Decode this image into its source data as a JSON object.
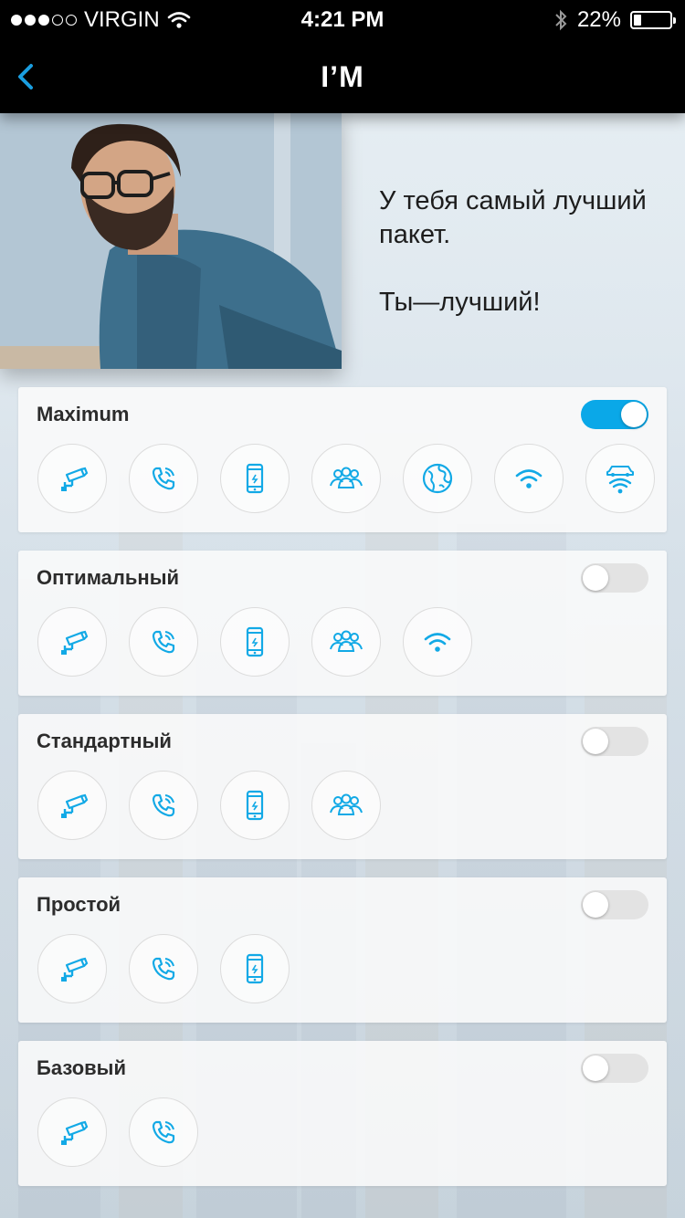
{
  "status": {
    "carrier": "VIRGIN",
    "time": "4:21 PM",
    "battery": "22%",
    "battery_level": 0.22,
    "signal_bars": 3,
    "signal_total": 5
  },
  "nav": {
    "title": "I’M",
    "back_icon": "chevron-left-icon"
  },
  "hero": {
    "line1": "У тебя самый лучший пакет.",
    "line2": "Ты—лучший!"
  },
  "colors": {
    "accent": "#0aa8e8",
    "icon": "#12a9e6",
    "bar": "#000000"
  },
  "plans": [
    {
      "name": "Maximum",
      "enabled": true,
      "features": [
        "camera",
        "phone",
        "mobile",
        "group",
        "globe",
        "wifi",
        "car-wifi"
      ]
    },
    {
      "name": "Оптимальный",
      "enabled": false,
      "features": [
        "camera",
        "phone",
        "mobile",
        "group",
        "wifi"
      ]
    },
    {
      "name": "Стандартный",
      "enabled": false,
      "features": [
        "camera",
        "phone",
        "mobile",
        "group"
      ]
    },
    {
      "name": "Простой",
      "enabled": false,
      "features": [
        "camera",
        "phone",
        "mobile"
      ]
    },
    {
      "name": "Базовый",
      "enabled": false,
      "features": [
        "camera",
        "phone"
      ]
    }
  ]
}
